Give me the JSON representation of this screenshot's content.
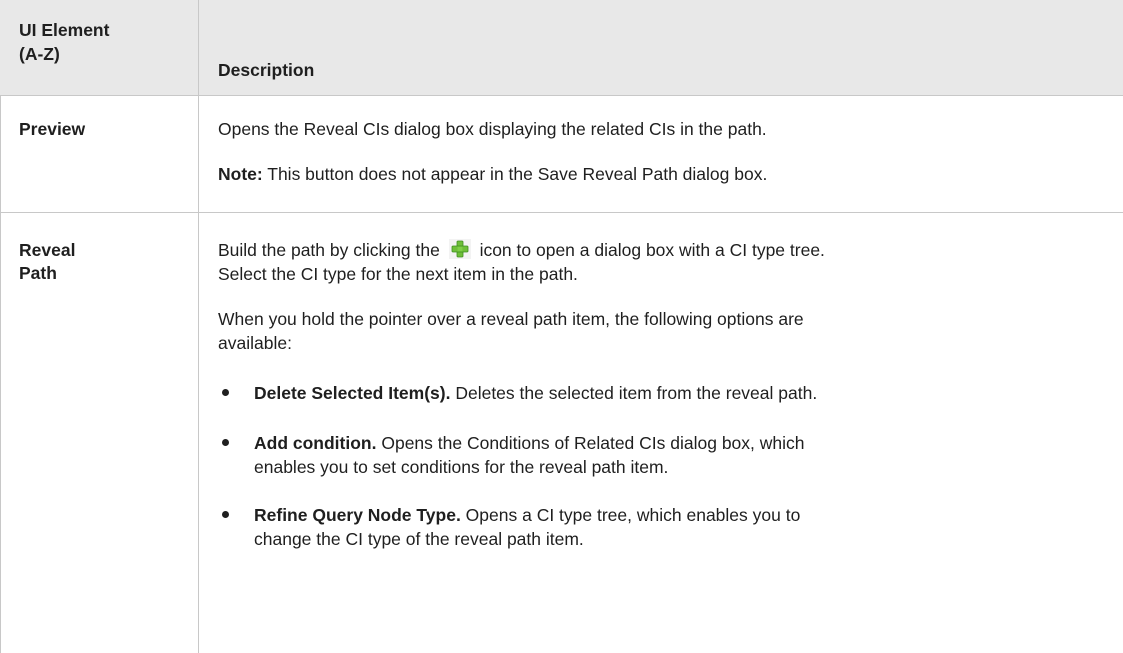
{
  "header": {
    "col1_line1": "UI Element",
    "col1_line2": "(A-Z)",
    "col2": "Description"
  },
  "rows": [
    {
      "name": "Preview",
      "description": "Opens the Reveal CIs dialog box displaying the related CIs in the path.",
      "note_label": "Note:",
      "note_text": " This button does not appear in the Save Reveal Path dialog box."
    },
    {
      "name_line1": "Reveal",
      "name_line2": "Path",
      "intro_before_icon": "Build the path by clicking the",
      "icon": "green-plus-icon",
      "intro_after_icon": "icon to open a dialog box with a CI type tree.",
      "intro_line2": "Select the CI type for the next item in the path.",
      "hover_line1": "When you hold the pointer over a reveal path item, the following options are",
      "hover_line2": "available:",
      "options": [
        {
          "label": "Delete Selected Item(s).",
          "text_line1": " Deletes the selected item from the reveal path."
        },
        {
          "label": "Add condition.",
          "text_line1": " Opens the Conditions of Related CIs dialog box, which",
          "text_line2": "enables you to set conditions for the reveal path item."
        },
        {
          "label": "Refine Query Node Type.",
          "text_line1": " Opens a CI type tree, which enables you to",
          "text_line2": "change the CI type of the reveal path item."
        }
      ]
    }
  ]
}
